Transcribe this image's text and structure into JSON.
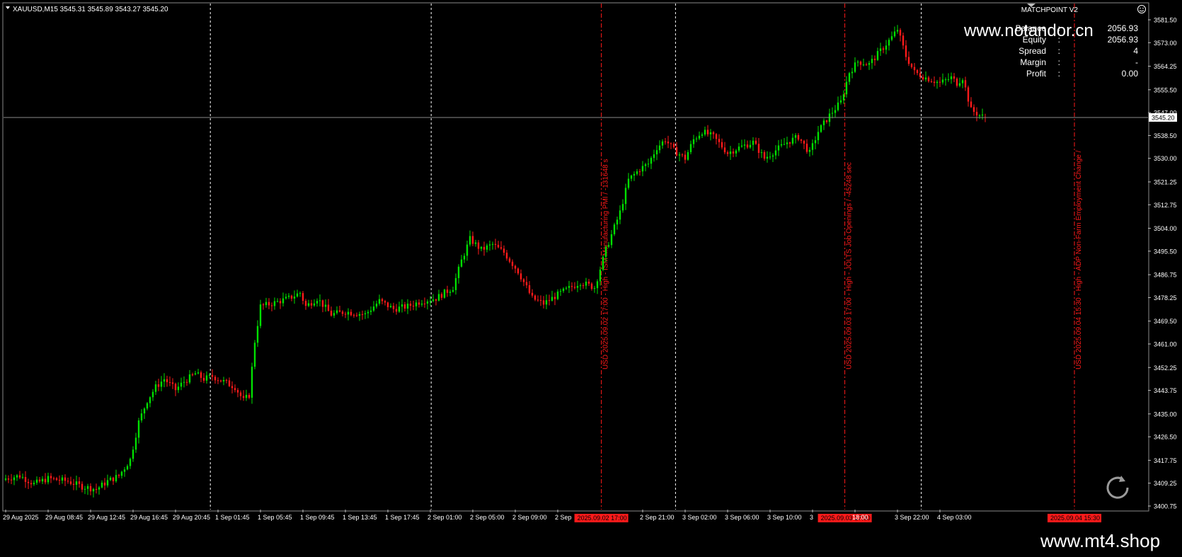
{
  "header": {
    "symbol_line": "XAUUSD,M15  3545.31 3545.89 3543.27 3545.20",
    "indicator_name": "MATCHPOINT V2"
  },
  "account": {
    "rows": [
      {
        "label": "Balance",
        "sep": ":",
        "value": "2056.93"
      },
      {
        "label": "Equity",
        "sep": ":",
        "value": "2056.93"
      },
      {
        "label": "Spread",
        "sep": ":",
        "value": "4"
      },
      {
        "label": "Margin",
        "sep": ":",
        "value": "-"
      },
      {
        "label": "Profit",
        "sep": ":",
        "value": "0.00"
      }
    ]
  },
  "watermarks": {
    "top": "www.notandor.cn",
    "bottom": "www.mt4.shop"
  },
  "events": [
    {
      "time_label": "2025.09.02 17:00",
      "text": "USD 2025.09.02 17:00 - High - ISM Manufacturing PMI / -131648 s"
    },
    {
      "time_label": "2025.09.03 17:00",
      "text": "USD 2025.09.03 17:00 - High - JOLTS Job Openings / -45248 sec"
    },
    {
      "time_label": "2025.09.04 15:30",
      "text": "USD 2025.09.04 15:30 - High - ADP Non-Farm Employment Change /"
    }
  ],
  "colors": {
    "background": "#000000",
    "bull": "#00e000",
    "bear": "#ff1a1a",
    "grid": "#ffffff",
    "event": "#ff1a1a",
    "price_line": "#8a8a8a"
  },
  "chart_data": {
    "type": "candlestick",
    "symbol": "XAUUSD",
    "timeframe": "M15",
    "ohlc_current": {
      "open": 3545.31,
      "high": 3545.89,
      "low": 3543.27,
      "close": 3545.2
    },
    "current_price": "3545.20",
    "ylim": [
      3400.75,
      3581.5
    ],
    "y_ticks": [
      "3581.50",
      "3573.00",
      "3564.25",
      "3555.50",
      "3547.00",
      "3538.50",
      "3530.00",
      "3521.25",
      "3512.75",
      "3504.00",
      "3495.50",
      "3486.75",
      "3478.25",
      "3469.50",
      "3461.00",
      "3452.25",
      "3443.75",
      "3435.00",
      "3426.50",
      "3417.75",
      "3409.25",
      "3400.75"
    ],
    "x_ticks": [
      "29 Aug 2025",
      "29 Aug 08:45",
      "29 Aug 12:45",
      "29 Aug 16:45",
      "29 Aug 20:45",
      "1 Sep 01:45",
      "1 Sep 05:45",
      "1 Sep 09:45",
      "1 Sep 13:45",
      "1 Sep 17:45",
      "2 Sep 01:00",
      "2 Sep 05:00",
      "2 Sep 09:00",
      "2 Sep",
      "2 Sep 21:00",
      "3 Sep 02:00",
      "3 Sep 06:00",
      "3 Sep 10:00",
      "3",
      "18:00",
      "3 Sep 22:00",
      "4 Sep 03:00"
    ],
    "x_tick_positions": [
      0,
      15,
      30,
      45,
      60,
      75,
      90,
      105,
      120,
      135,
      150,
      165,
      180,
      195,
      225,
      240,
      255,
      270,
      285,
      300,
      315,
      330
    ],
    "day_separators": [
      72.3,
      150.3,
      236.6,
      323.4
    ],
    "event_candle_index": [
      210.4,
      296.4,
      377.5
    ],
    "anchors": [
      [
        0,
        3411
      ],
      [
        5,
        3412
      ],
      [
        10,
        3409
      ],
      [
        15,
        3411
      ],
      [
        22,
        3410
      ],
      [
        27,
        3408
      ],
      [
        32,
        3407
      ],
      [
        36,
        3410
      ],
      [
        40,
        3412
      ],
      [
        44,
        3418
      ],
      [
        47,
        3432
      ],
      [
        50,
        3440
      ],
      [
        53,
        3445
      ],
      [
        56,
        3448
      ],
      [
        60,
        3444
      ],
      [
        63,
        3447
      ],
      [
        67,
        3450
      ],
      [
        70,
        3448
      ],
      [
        73,
        3449
      ],
      [
        77,
        3447
      ],
      [
        81,
        3445
      ],
      [
        84,
        3440
      ],
      [
        86,
        3442
      ],
      [
        88,
        3462
      ],
      [
        90,
        3475
      ],
      [
        94,
        3476
      ],
      [
        100,
        3478
      ],
      [
        104,
        3480
      ],
      [
        106,
        3475
      ],
      [
        110,
        3478
      ],
      [
        115,
        3472
      ],
      [
        120,
        3473
      ],
      [
        127,
        3472
      ],
      [
        132,
        3477
      ],
      [
        137,
        3474
      ],
      [
        142,
        3475
      ],
      [
        147,
        3477
      ],
      [
        152,
        3478
      ],
      [
        158,
        3482
      ],
      [
        161,
        3492
      ],
      [
        164,
        3500
      ],
      [
        168,
        3496
      ],
      [
        172,
        3498
      ],
      [
        176,
        3495
      ],
      [
        181,
        3488
      ],
      [
        186,
        3478
      ],
      [
        190,
        3476
      ],
      [
        196,
        3480
      ],
      [
        203,
        3484
      ],
      [
        208,
        3482
      ],
      [
        212,
        3496
      ],
      [
        217,
        3510
      ],
      [
        220,
        3522
      ],
      [
        224,
        3526
      ],
      [
        227,
        3528
      ],
      [
        230,
        3534
      ],
      [
        233,
        3537
      ],
      [
        236,
        3533
      ],
      [
        240,
        3530
      ],
      [
        243,
        3537
      ],
      [
        246,
        3540
      ],
      [
        250,
        3538
      ],
      [
        255,
        3532
      ],
      [
        259,
        3534
      ],
      [
        264,
        3536
      ],
      [
        268,
        3530
      ],
      [
        272,
        3533
      ],
      [
        276,
        3536
      ],
      [
        280,
        3538
      ],
      [
        284,
        3532
      ],
      [
        287,
        3540
      ],
      [
        291,
        3546
      ],
      [
        295,
        3551
      ],
      [
        298,
        3562
      ],
      [
        301,
        3566
      ],
      [
        305,
        3565
      ],
      [
        309,
        3570
      ],
      [
        313,
        3575
      ],
      [
        315,
        3578
      ],
      [
        318,
        3568
      ],
      [
        321,
        3562
      ],
      [
        325,
        3560
      ],
      [
        330,
        3558
      ],
      [
        334,
        3560
      ],
      [
        336,
        3558
      ],
      [
        338,
        3560
      ],
      [
        341,
        3548
      ],
      [
        344,
        3546
      ],
      [
        346,
        3545.2
      ]
    ]
  }
}
